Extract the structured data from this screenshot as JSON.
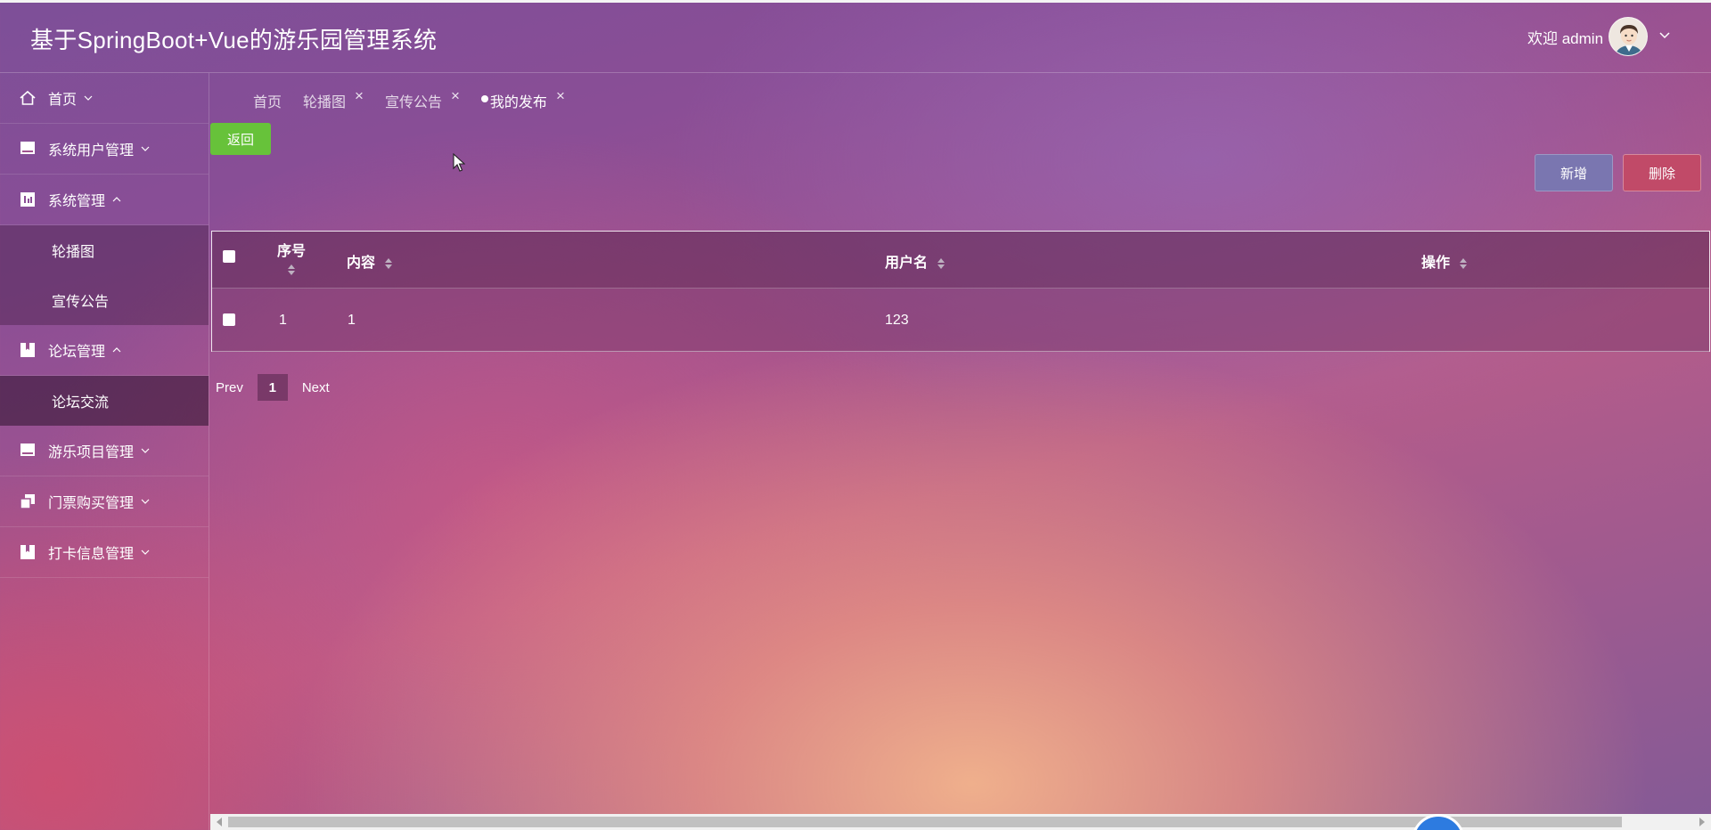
{
  "header": {
    "app_title": "基于SpringBoot+Vue的游乐园管理系统",
    "welcome": "欢迎 admin",
    "avatar_icon": "user-avatar-icon"
  },
  "sidebar": {
    "items": [
      {
        "label": "首页",
        "icon": "home-icon",
        "expanded": false
      },
      {
        "label": "系统用户管理",
        "icon": "monitor-icon",
        "expanded": false
      },
      {
        "label": "系统管理",
        "icon": "chart-icon",
        "expanded": true,
        "children": [
          "轮播图",
          "宣传公告"
        ]
      },
      {
        "label": "论坛管理",
        "icon": "bookmark-icon",
        "expanded": true,
        "children": [
          "论坛交流"
        ]
      },
      {
        "label": "游乐项目管理",
        "icon": "monitor-icon",
        "expanded": false
      },
      {
        "label": "门票购买管理",
        "icon": "copy-icon",
        "expanded": false
      },
      {
        "label": "打卡信息管理",
        "icon": "bookmark-icon",
        "expanded": false
      }
    ]
  },
  "tabs": [
    {
      "label": "首页",
      "closable": false,
      "active": false
    },
    {
      "label": "轮播图",
      "closable": true,
      "active": false
    },
    {
      "label": "宣传公告",
      "closable": true,
      "active": false
    },
    {
      "label": "我的发布",
      "closable": true,
      "active": true
    }
  ],
  "buttons": {
    "back": "返回",
    "add": "新增",
    "delete": "删除"
  },
  "table": {
    "columns": [
      "序号",
      "内容",
      "用户名",
      "操作"
    ],
    "rows": [
      {
        "index": "1",
        "content": "1",
        "username": "123",
        "action": ""
      }
    ]
  },
  "pagination": {
    "prev": "Prev",
    "current": "1",
    "next": "Next"
  },
  "colors": {
    "back_button": "#67c23a",
    "add_button": "#7a76b0",
    "delete_button": "#c14a68"
  }
}
